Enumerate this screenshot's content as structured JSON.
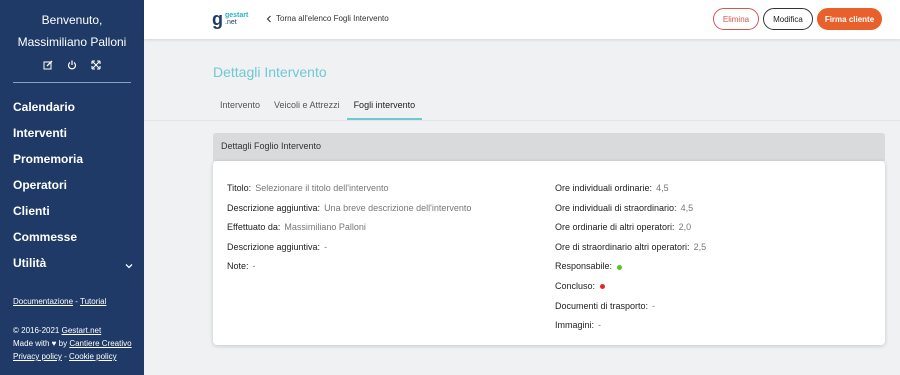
{
  "sidebar": {
    "welcome_line1": "Benvenuto,",
    "welcome_line2": "Massimiliano Palloni",
    "icons": [
      "edit-icon",
      "power-icon",
      "expand-icon"
    ],
    "nav": [
      {
        "label": "Calendario"
      },
      {
        "label": "Interventi"
      },
      {
        "label": "Promemoria"
      },
      {
        "label": "Operatori"
      },
      {
        "label": "Clienti"
      },
      {
        "label": "Commesse"
      },
      {
        "label": "Utilità"
      }
    ],
    "links": {
      "docs": "Documentazione",
      "sep": " - ",
      "tutorial": "Tutorial"
    },
    "footer": {
      "copyright_prefix": "© 2016-2021 ",
      "copyright_link": "Gestart.net",
      "made_prefix": "Made with ♥ by ",
      "made_link": "Cantiere Creativo",
      "privacy": "Privacy policy",
      "sep": " - ",
      "cookie": "Cookie policy"
    }
  },
  "topbar": {
    "logo_g": "g",
    "logo_line1": "gestart",
    "logo_line2": ".net",
    "back_label": "Torna all'elenco Fogli Intervento",
    "buttons": {
      "delete": "Elimina",
      "edit": "Modifica",
      "sign": "Firma cliente"
    }
  },
  "main": {
    "title": "Dettagli Intervento",
    "tabs": [
      {
        "label": "Intervento",
        "active": false
      },
      {
        "label": "Veicoli e Attrezzi",
        "active": false
      },
      {
        "label": "Fogli intervento",
        "active": true
      }
    ],
    "card_title": "Dettagli Foglio Intervento",
    "left_fields": [
      {
        "key": "Titolo:",
        "value": "Selezionare il titolo dell'intervento"
      },
      {
        "key": "Descrizione aggiuntiva:",
        "value": "Una breve descrizione dell'intervento"
      },
      {
        "key": "Effettuato da:",
        "value": "Massimiliano Palloni"
      },
      {
        "key": "Descrizione aggiuntiva:",
        "value": "-"
      },
      {
        "key": "Note:",
        "value": "-"
      }
    ],
    "right_fields": [
      {
        "key": "Ore individuali ordinarie:",
        "value": "4,5"
      },
      {
        "key": "Ore individuali di straordinario:",
        "value": "4,5"
      },
      {
        "key": "Ore ordinarie di altri operatori:",
        "value": "2,0"
      },
      {
        "key": "Ore di straordinario altri operatori:",
        "value": "2,5"
      },
      {
        "key": "Responsabile:",
        "value": "",
        "status_color": "#5cc130"
      },
      {
        "key": "Concluso:",
        "value": "",
        "status_color": "#e02a2a"
      },
      {
        "key": "Documenti di trasporto:",
        "value": "-"
      },
      {
        "key": "Immagini:",
        "value": "-"
      }
    ]
  },
  "colors": {
    "sidebar_bg": "#1f3a66",
    "accent": "#6ec9d3",
    "danger": "#d9534f",
    "primary_button": "#e8612c"
  }
}
